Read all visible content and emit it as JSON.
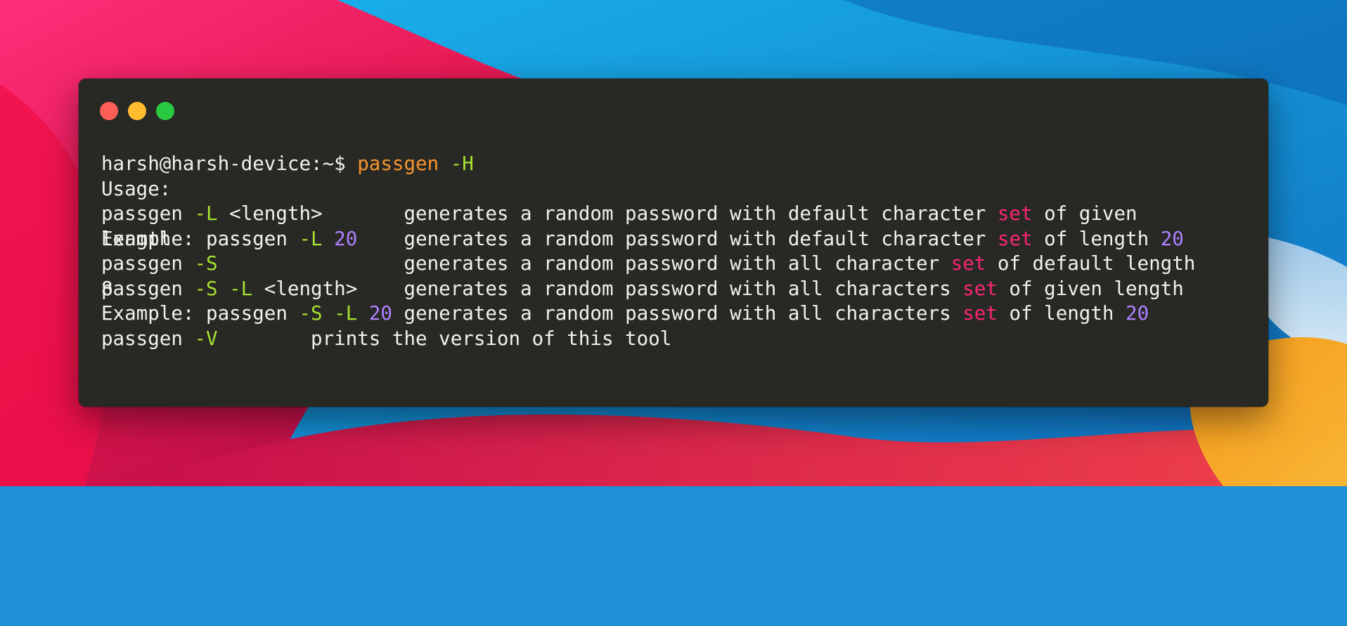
{
  "colors": {
    "terminal_bg": "#282824",
    "text": "#f1f1ee",
    "command": "#f6952d",
    "flag": "#a6e22e",
    "keyword": "#f92672",
    "number": "#ae81ff",
    "close": "#ff5f57",
    "minimize": "#febc2e",
    "maximize": "#28c840"
  },
  "terminal": {
    "prompt": "harsh@harsh-device:~$",
    "command": "passgen",
    "command_flag": "-H",
    "usage": "Usage:",
    "lines": [
      {
        "prefix": "passgen ",
        "flag": "-L",
        "arg": " <length>       ",
        "desc": "generates a random password with default character ",
        "kw": "set",
        "tail": " of given",
        "num": ""
      },
      {
        "prefix": "Example: passgen ",
        "flag": "-L",
        "arg": " ",
        "argnum": "20",
        "pad": "    ",
        "desc": "generates a random password with default character ",
        "kw": "set",
        "tail": " of length ",
        "num": "20"
      },
      {
        "prefix": "passgen ",
        "flag": "-S",
        "arg": "                ",
        "desc": "generates a random password with all character ",
        "kw": "set",
        "tail": " of default length",
        "num": ""
      },
      {
        "prefix": "passgen ",
        "flag": "-S -L",
        "arg": " <length>    ",
        "desc": "generates a random password with all characters ",
        "kw": "set",
        "tail": " of given length",
        "num": ""
      },
      {
        "prefix": "Example: passgen ",
        "flag": "-S -L",
        "arg": " ",
        "argnum": "20",
        "pad": " ",
        "desc": "generates a random password with all characters ",
        "kw": "set",
        "tail": " of length ",
        "num": "20"
      }
    ],
    "overlap_wrap_1": "length",
    "overlap_wrap_2": "8",
    "version_line": {
      "prefix": "passgen ",
      "flag": "-V",
      "desc": "        prints the version of this tool"
    }
  }
}
